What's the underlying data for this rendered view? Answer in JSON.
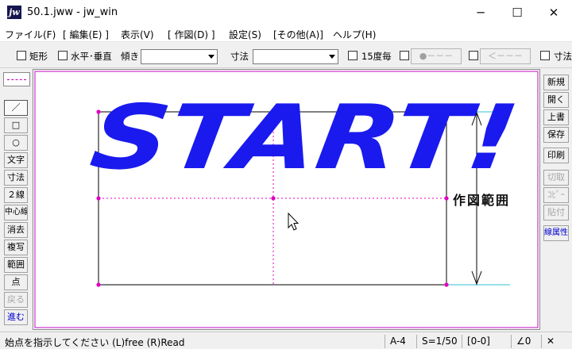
{
  "titlebar": {
    "app_icon_text": "jw",
    "title": "50.1.jww - jw_win",
    "minimize": "─",
    "maximize": "☐",
    "close": "✕"
  },
  "menu": {
    "items": [
      "ファイル(F)",
      "[ 編集(E) ]",
      "表示(V)",
      "[ 作図(D) ]",
      "設定(S)",
      "[その他(A)]",
      "ヘルプ(H)"
    ]
  },
  "options": {
    "rect_label": "矩形",
    "hv_label": "水平･垂直",
    "tilt_label": "傾き",
    "tilt_value": "",
    "dim_label": "寸法",
    "dim_value": "",
    "deg15_label": "15度毎",
    "dot_line_btn": "●－－－",
    "arrow_line_btn": "＜－－－",
    "dim_cut_label": "寸法"
  },
  "left_tools": [
    "／",
    "□",
    "○",
    "文字",
    "寸法",
    "２線",
    "中心線",
    "消去",
    "複写",
    "範囲",
    "点",
    "戻る",
    "進む"
  ],
  "right_tools": [
    "新規",
    "開く",
    "上書",
    "保存",
    "印刷",
    "切取",
    "ｺﾋﾟｰ",
    "貼付",
    "線属性"
  ],
  "canvas": {
    "banner_text": "START!",
    "area_label": "作図範囲",
    "colors": {
      "banner": "#1a1aee",
      "construction": "#e000c0",
      "dimension": "#30c0d0",
      "border": "#cc33cc"
    }
  },
  "status": {
    "message": "始点を指示してください (L)free (R)Read",
    "paper": "A-4",
    "scale": "S=1/50",
    "layer": "[0-0]",
    "angle": "∠0",
    "close_mark": "✕"
  }
}
